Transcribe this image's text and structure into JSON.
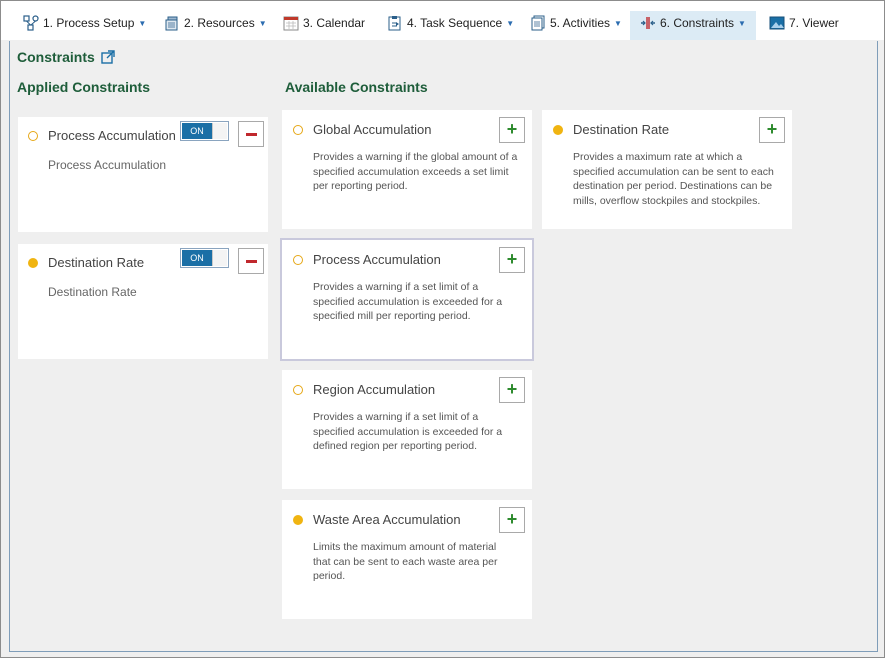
{
  "toolbar": {
    "items": [
      {
        "label": "1. Process Setup",
        "icon": "process-setup-icon",
        "has_menu": true
      },
      {
        "label": "2. Resources",
        "icon": "resources-icon",
        "has_menu": true
      },
      {
        "label": "3. Calendar",
        "icon": "calendar-icon",
        "has_menu": false
      },
      {
        "label": "4. Task Sequence",
        "icon": "task-sequence-icon",
        "has_menu": true
      },
      {
        "label": "5. Activities",
        "icon": "activities-icon",
        "has_menu": true
      },
      {
        "label": "6. Constraints",
        "icon": "constraints-icon",
        "has_menu": true,
        "active": true
      },
      {
        "label": "7. Viewer",
        "icon": "viewer-icon",
        "has_menu": false
      }
    ]
  },
  "page": {
    "title": "Constraints",
    "applied_heading": "Applied Constraints",
    "available_heading": "Available Constraints"
  },
  "applied": [
    {
      "title": "Process Accumulation",
      "subtitle": "Process Accumulation",
      "toggle_label": "ON",
      "enabled": true,
      "dot": "hollow"
    },
    {
      "title": "Destination Rate",
      "subtitle": "Destination Rate",
      "toggle_label": "ON",
      "enabled": true,
      "dot": "filled"
    }
  ],
  "available": [
    {
      "title": "Global Accumulation",
      "description": "Provides a warning if the global amount of a specified accumulation exceeds a set limit per reporting period.",
      "dot": "hollow"
    },
    {
      "title": "Destination Rate",
      "description": "Provides a maximum rate at which a specified accumulation can be sent to each destination per period. Destinations can be mills, overflow stockpiles and stockpiles.",
      "dot": "filled"
    },
    {
      "title": "Process Accumulation",
      "description": "Provides a warning if a set limit of a specified accumulation is exceeded for a specified mill per reporting period.",
      "dot": "hollow",
      "selected": true
    },
    {
      "title": "Region Accumulation",
      "description": "Provides a warning if a set limit of a specified accumulation is exceeded for a defined region per reporting period.",
      "dot": "hollow"
    },
    {
      "title": "Waste Area Accumulation",
      "description": "Limits the maximum amount of material that can be sent to each waste area per period.",
      "dot": "filled"
    }
  ],
  "colors": {
    "heading": "#1e5d3a",
    "accent_dot": "#f0b411",
    "toggle_on": "#1a6fa6",
    "plus": "#2e8b2e",
    "minus": "#c0282d",
    "active_tab_bg": "#dcebf5"
  }
}
